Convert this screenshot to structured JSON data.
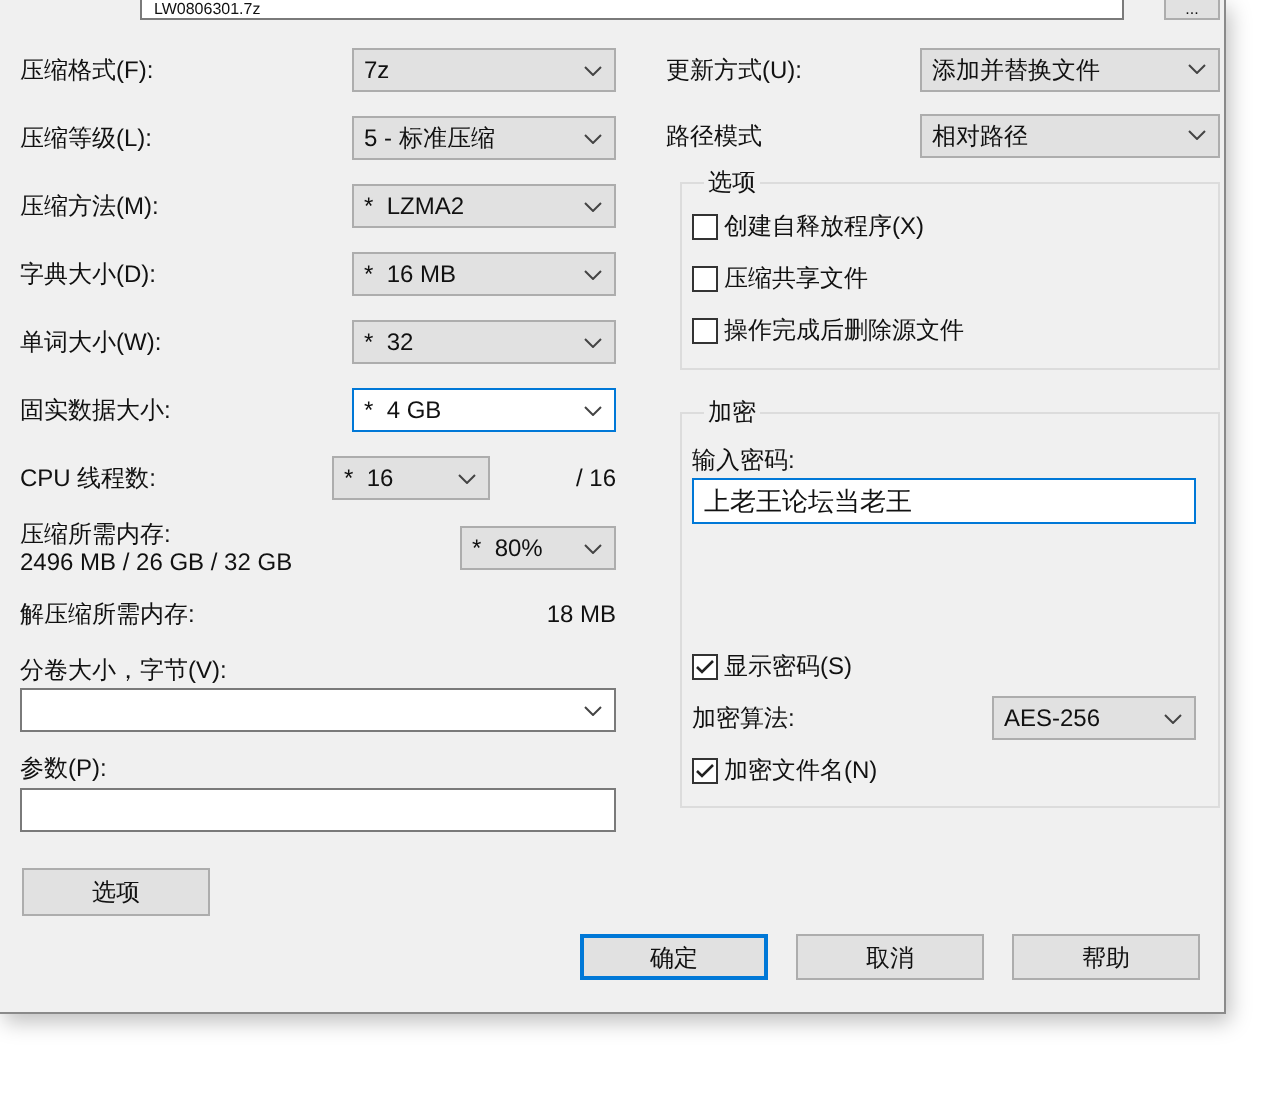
{
  "archive_field": {
    "value": "LW0806301.7z"
  },
  "browse_button": {
    "label": "..."
  },
  "left_fields": [
    {
      "kind": "select",
      "label": "压缩格式(F):",
      "value": "7z",
      "focused": false
    },
    {
      "kind": "select",
      "label": "压缩等级(L):",
      "value": "5 - 标准压缩",
      "focused": false
    },
    {
      "kind": "select",
      "label": "压缩方法(M):",
      "value": "*  LZMA2",
      "focused": false
    },
    {
      "kind": "select",
      "label": "字典大小(D):",
      "value": "*  16 MB",
      "focused": false
    },
    {
      "kind": "select",
      "label": "单词大小(W):",
      "value": "*  32",
      "focused": false
    },
    {
      "kind": "select",
      "label": "固实数据大小:",
      "value": "*  4 GB",
      "focused": true
    },
    {
      "kind": "threads",
      "label": "CPU 线程数:",
      "value": "*  16",
      "note": "/ 16",
      "focused": false
    },
    {
      "kind": "memory",
      "label": "压缩所需内存:",
      "detail": "2496 MB / 26 GB / 32 GB",
      "value": "*  80%",
      "focused": false
    },
    {
      "kind": "info",
      "label": "解压缩所需内存:",
      "value": "18 MB"
    }
  ],
  "volume": {
    "label": "分卷大小，字节(V):"
  },
  "parameters": {
    "label": "参数(P):"
  },
  "options_button": {
    "label": "选项"
  },
  "right_fields": [
    {
      "label": "更新方式(U):",
      "value": "添加并替换文件"
    },
    {
      "label": "路径模式",
      "value": "相对路径"
    }
  ],
  "options_group": {
    "title": "选项",
    "checkboxes": [
      {
        "label": "创建自释放程序(X)",
        "checked": false
      },
      {
        "label": "压缩共享文件",
        "checked": false
      },
      {
        "label": "操作完成后删除源文件",
        "checked": false
      }
    ]
  },
  "encryption_group": {
    "title": "加密",
    "password_label": "输入密码:",
    "password": "上老王论坛当老王",
    "show_password": {
      "label": "显示密码(S)",
      "checked": true
    },
    "method_label": "加密算法:",
    "method": "AES-256",
    "encrypt_names": {
      "label": "加密文件名(N)",
      "checked": true
    }
  },
  "buttons": [
    {
      "label": "确定",
      "default": true
    },
    {
      "label": "取消",
      "default": false
    },
    {
      "label": "帮助",
      "default": false
    }
  ]
}
